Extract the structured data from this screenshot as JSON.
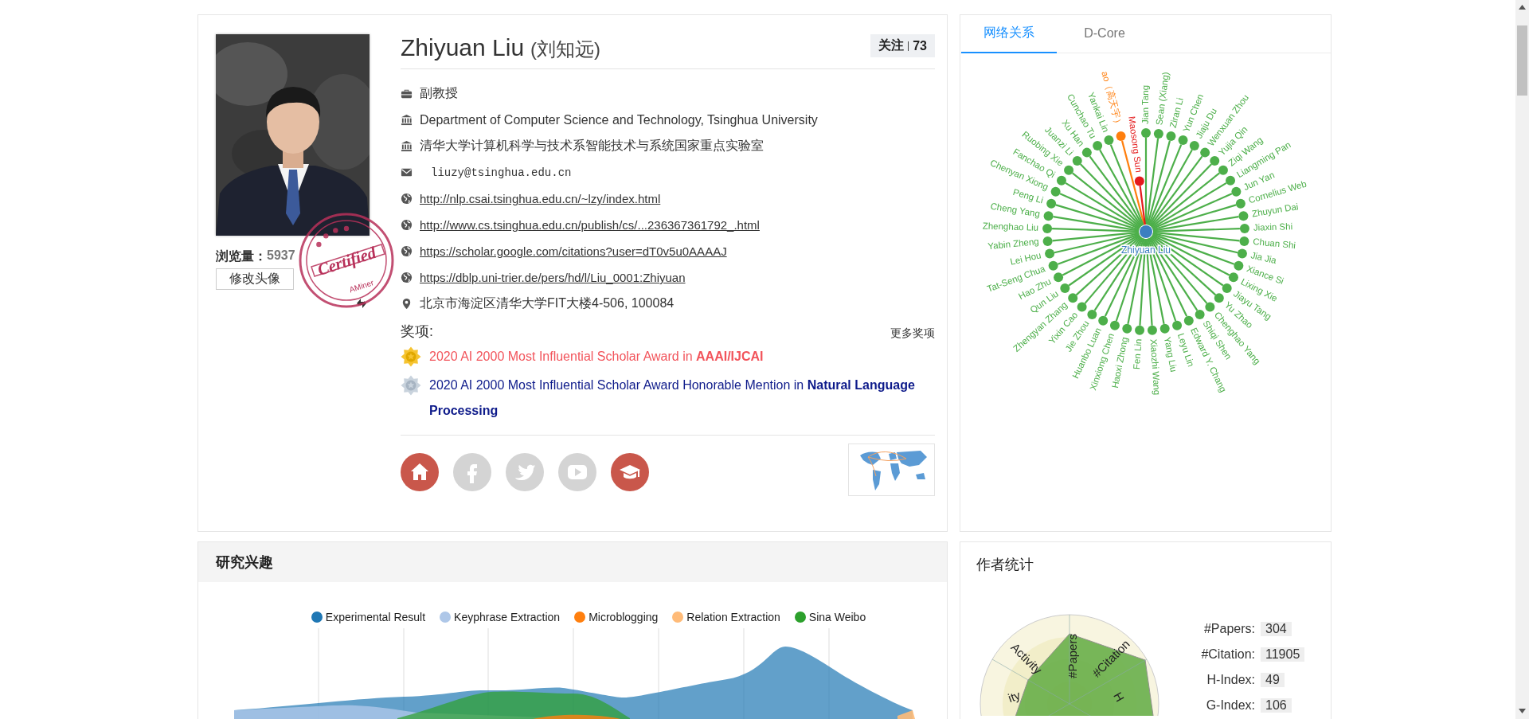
{
  "profile": {
    "stamp": {
      "title": "Certified",
      "brand": "AMiner"
    },
    "views_label": "浏览量：",
    "views": "5937",
    "edit_avatar_button": "修改头像",
    "name": "Zhiyuan Liu",
    "name_zh": "(刘知远)",
    "follow_label": "关注",
    "follow_count": "73",
    "details": [
      {
        "kind": "position",
        "text": "副教授"
      },
      {
        "kind": "affiliation",
        "text": "Department of Computer Science and Technology, Tsinghua University"
      },
      {
        "kind": "affiliation",
        "text": "清华大学计算机科学与技术系智能技术与系统国家重点实验室"
      },
      {
        "kind": "email",
        "text": "liuzy@tsinghua.edu.cn"
      },
      {
        "kind": "link",
        "text": "http://nlp.csai.tsinghua.edu.cn/~lzy/index.html"
      },
      {
        "kind": "link",
        "text": "http://www.cs.tsinghua.edu.cn/publish/cs/...236367361792_.html"
      },
      {
        "kind": "link",
        "text": "https://scholar.google.com/citations?user=dT0v5u0AAAAJ"
      },
      {
        "kind": "link",
        "text": "https://dblp.uni-trier.de/pers/hd/l/Liu_0001:Zhiyuan"
      },
      {
        "kind": "address",
        "text": "北京市海淀区清华大学FIT大楼4-506, 100084"
      }
    ],
    "awards_title": "奖项:",
    "more_awards": "更多奖项",
    "awards": [
      {
        "kind": "gold",
        "text": "2020 AI 2000 Most Influential Scholar Award in **AAAI/IJCAI**"
      },
      {
        "kind": "silver",
        "text": "2020 AI 2000 Most Influential Scholar Award Honorable Mention in **Natural Language Processing**"
      }
    ],
    "social": [
      {
        "kind": "home",
        "on": true
      },
      {
        "kind": "facebook",
        "on": false
      },
      {
        "kind": "twitter",
        "on": false
      },
      {
        "kind": "youtube",
        "on": false
      },
      {
        "kind": "scholar",
        "on": true
      }
    ]
  },
  "network": {
    "tabs": [
      {
        "label": "网络关系",
        "selected": true
      },
      {
        "label": "D-Core",
        "selected": false
      }
    ],
    "center": "Zhiyuan Liu",
    "inner_node": {
      "name": "Maosong Sun",
      "color": "#e41a1c"
    },
    "nodes_left": [
      {
        "name": "ao（高天宇）",
        "color": "#ff7f0e"
      },
      {
        "name": "Yankai Lin",
        "color": "#4daf4a"
      },
      {
        "name": "Cunchao Tu",
        "color": "#4daf4a"
      },
      {
        "name": "Xu Han",
        "color": "#4daf4a"
      },
      {
        "name": "Juanzi Li",
        "color": "#4daf4a"
      },
      {
        "name": "Ruobing Xie",
        "color": "#4daf4a"
      },
      {
        "name": "Fanchao Qi",
        "color": "#4daf4a"
      },
      {
        "name": "Chenyan Xiong",
        "color": "#4daf4a"
      },
      {
        "name": "Peng Li",
        "color": "#4daf4a"
      },
      {
        "name": "Cheng Yang",
        "color": "#4daf4a"
      },
      {
        "name": "Zhenghao Liu",
        "color": "#4daf4a"
      },
      {
        "name": "Yabin Zheng",
        "color": "#4daf4a"
      },
      {
        "name": "Lei Hou",
        "color": "#4daf4a"
      },
      {
        "name": "Tat-Seng Chua",
        "color": "#4daf4a"
      },
      {
        "name": "Hao Zhu",
        "color": "#4daf4a"
      },
      {
        "name": "Qun Liu",
        "color": "#4daf4a"
      },
      {
        "name": "Zhengyan Zhang",
        "color": "#4daf4a"
      },
      {
        "name": "Yixin Cao",
        "color": "#4daf4a"
      },
      {
        "name": "Jie Zhou",
        "color": "#4daf4a"
      },
      {
        "name": "Huanbo Luan",
        "color": "#4daf4a"
      },
      {
        "name": "Xinxiong Chen",
        "color": "#4daf4a"
      },
      {
        "name": "Haoxi Zhong",
        "color": "#4daf4a"
      },
      {
        "name": "Fen Lin",
        "color": "#4daf4a"
      }
    ],
    "nodes_right": [
      {
        "name": "Jian Tang",
        "color": "#4daf4a"
      },
      {
        "name": "Sean (Xiang)",
        "color": "#4daf4a"
      },
      {
        "name": "Ziran Li",
        "color": "#4daf4a"
      },
      {
        "name": "Yun Chen",
        "color": "#4daf4a"
      },
      {
        "name": "Jiaju Du",
        "color": "#4daf4a"
      },
      {
        "name": "Wenxuan Zhou",
        "color": "#4daf4a"
      },
      {
        "name": "Yujia Qin",
        "color": "#4daf4a"
      },
      {
        "name": "Ziqi Wang",
        "color": "#4daf4a"
      },
      {
        "name": "Liangming Pan",
        "color": "#4daf4a"
      },
      {
        "name": "Jun Yan",
        "color": "#4daf4a"
      },
      {
        "name": "Cornelius Web",
        "color": "#4daf4a"
      },
      {
        "name": "Zhuyun Dai",
        "color": "#4daf4a"
      },
      {
        "name": "Jiaxin Shi",
        "color": "#4daf4a"
      },
      {
        "name": "Chuan Shi",
        "color": "#4daf4a"
      },
      {
        "name": "Jia Jia",
        "color": "#4daf4a"
      },
      {
        "name": "Xiance Si",
        "color": "#4daf4a"
      },
      {
        "name": "Lixing Xie",
        "color": "#4daf4a"
      },
      {
        "name": "Jiayu Tang",
        "color": "#4daf4a"
      },
      {
        "name": "Yu Zhao",
        "color": "#4daf4a"
      },
      {
        "name": "Chenghao Yang",
        "color": "#4daf4a"
      },
      {
        "name": "Shiqi Shen",
        "color": "#4daf4a"
      },
      {
        "name": "Edward Y. Chang",
        "color": "#4daf4a"
      },
      {
        "name": "Leyu Lin",
        "color": "#4daf4a"
      },
      {
        "name": "Yang Liu",
        "color": "#4daf4a"
      },
      {
        "name": "Xiaozhi Wang",
        "color": "#4daf4a"
      }
    ]
  },
  "interests": {
    "title": "研究兴趣",
    "legend": [
      {
        "label": "Experimental Result",
        "color": "#1f77b4"
      },
      {
        "label": "Keyphrase Extraction",
        "color": "#aec7e8"
      },
      {
        "label": "Microblogging",
        "color": "#ff7f0e"
      },
      {
        "label": "Relation Extraction",
        "color": "#ffbb78"
      },
      {
        "label": "Sina Weibo",
        "color": "#2ca02c"
      }
    ]
  },
  "stats": {
    "title": "作者统计",
    "radar_labels": [
      "#Papers",
      "#Citation",
      "Activity",
      "ity",
      "H"
    ],
    "items": [
      {
        "label": "#Papers:",
        "value": "304"
      },
      {
        "label": "#Citation:",
        "value": "11905"
      },
      {
        "label": "H-Index:",
        "value": "49"
      },
      {
        "label": "G-Index:",
        "value": "106"
      }
    ]
  }
}
